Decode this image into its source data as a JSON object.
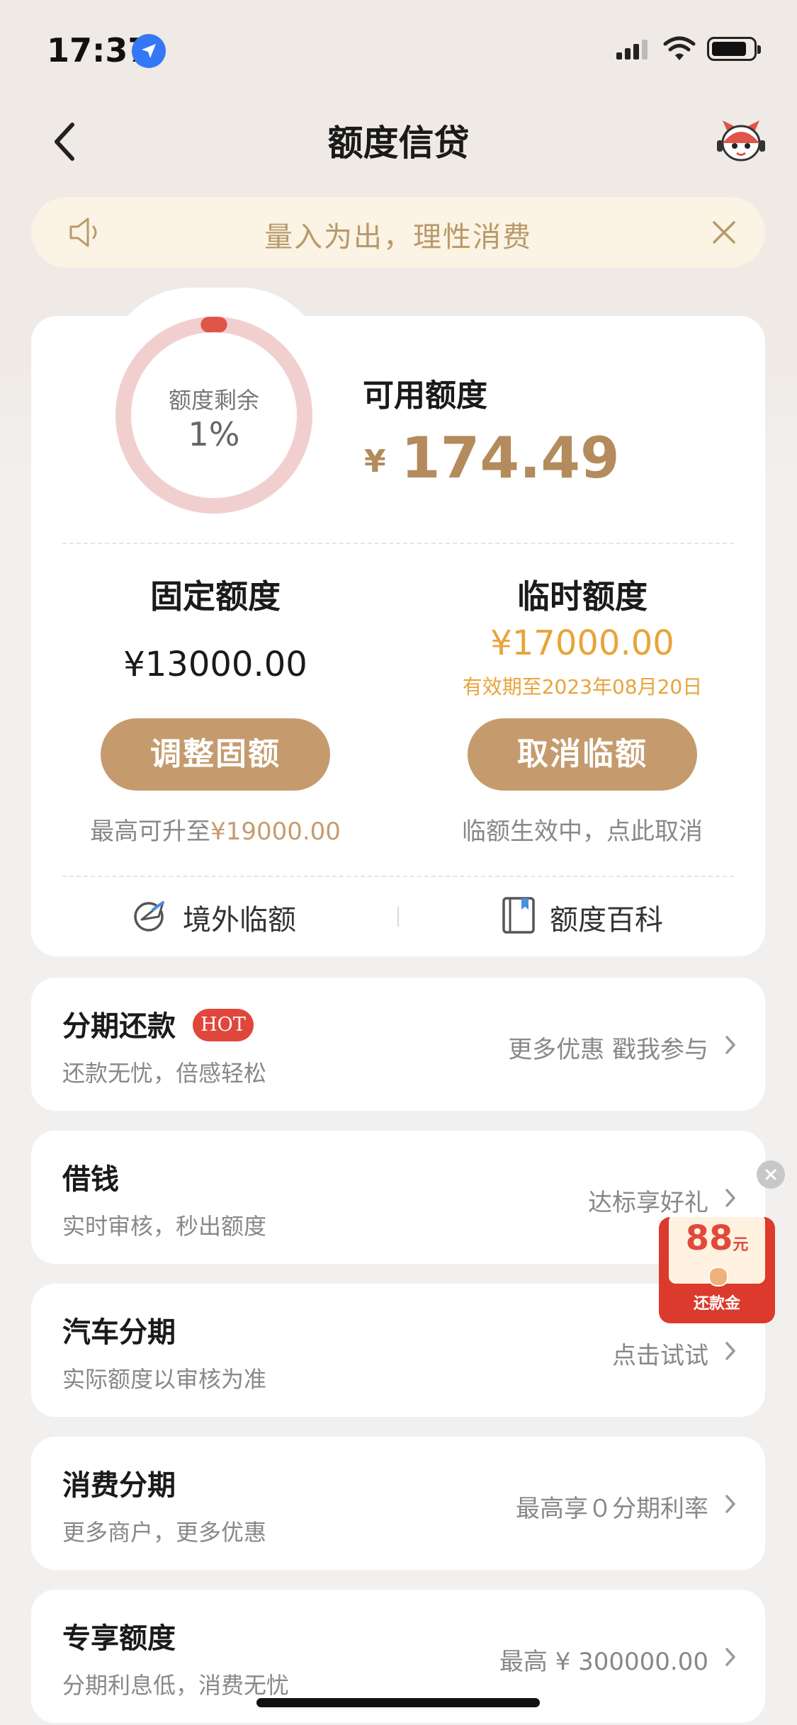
{
  "status_bar": {
    "time": "17:37"
  },
  "nav": {
    "title": "额度信贷"
  },
  "notice": {
    "text": "量入为出，理性消费"
  },
  "summary": {
    "ring_label": "额度剩余",
    "ring_percent_text": "1%",
    "ring_percent": 1,
    "available_label": "可用额度",
    "currency": "¥",
    "available_amount": "174.49"
  },
  "fixed": {
    "title": "固定额度",
    "amount": "¥13000.00",
    "button": "调整固额",
    "note_prefix": "最高可升至",
    "note_amount": "¥19000.00"
  },
  "temporary": {
    "title": "临时额度",
    "amount": "¥17000.00",
    "validity": "有效期至2023年08月20日",
    "button": "取消临额",
    "note": "临额生效中，点此取消"
  },
  "links": {
    "overseas": "境外临额",
    "wiki": "额度百科"
  },
  "rows": [
    {
      "title": "分期还款",
      "badge": "HOT",
      "subtitle": "还款无忧，倍感轻松",
      "right": "更多优惠 戳我参与"
    },
    {
      "title": "借钱",
      "subtitle": "实时审核，秒出额度",
      "right": "达标享好礼"
    },
    {
      "title": "汽车分期",
      "subtitle": "实际额度以审核为准",
      "right": "点击试试"
    },
    {
      "title": "消费分期",
      "subtitle": "更多商户，更多优惠",
      "right": "最高享０分期利率"
    },
    {
      "title": "专享额度",
      "subtitle": "分期利息低，消费无忧",
      "right": "最高 ¥ 300000.00"
    }
  ],
  "promo": {
    "amount": "88",
    "unit": "元",
    "caption": "还款金"
  },
  "colors": {
    "accent": "#c59b6e",
    "amount": "#b48b5c",
    "temp": "#e8a43a",
    "hot": "#e0473c",
    "ring": "#f2cfcf",
    "ring_dot": "#e0544a"
  }
}
